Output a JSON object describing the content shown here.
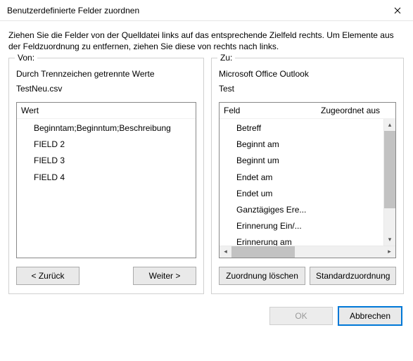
{
  "window": {
    "title": "Benutzerdefinierte Felder zuordnen"
  },
  "instructions": "Ziehen Sie die Felder von der Quelldatei links auf das entsprechende Zielfeld rechts. Um Elemente aus der Feldzuordnung zu entfernen, ziehen Sie diese von rechts nach links.",
  "source": {
    "legend": "Von:",
    "type": "Durch Trennzeichen getrennte Werte",
    "file": "TestNeu.csv",
    "header": "Wert",
    "items": [
      "Beginntam;Beginntum;Beschreibung",
      "FIELD 2",
      "FIELD 3",
      "FIELD 4"
    ],
    "back_label": "< Zurück",
    "next_label": "Weiter >"
  },
  "target": {
    "legend": "Zu:",
    "type": "Microsoft Office Outlook",
    "folder": "Test",
    "header_field": "Feld",
    "header_mapped": "Zugeordnet aus",
    "items": [
      "Betreff",
      "Beginnt am",
      "Beginnt um",
      "Endet am",
      "Endet um",
      "Ganztägiges Ere...",
      "Erinnerung Ein/...",
      "Erinnerung am"
    ],
    "clear_label": "Zuordnung löschen",
    "default_label": "Standardzuordnung"
  },
  "footer": {
    "ok_label": "OK",
    "cancel_label": "Abbrechen"
  }
}
